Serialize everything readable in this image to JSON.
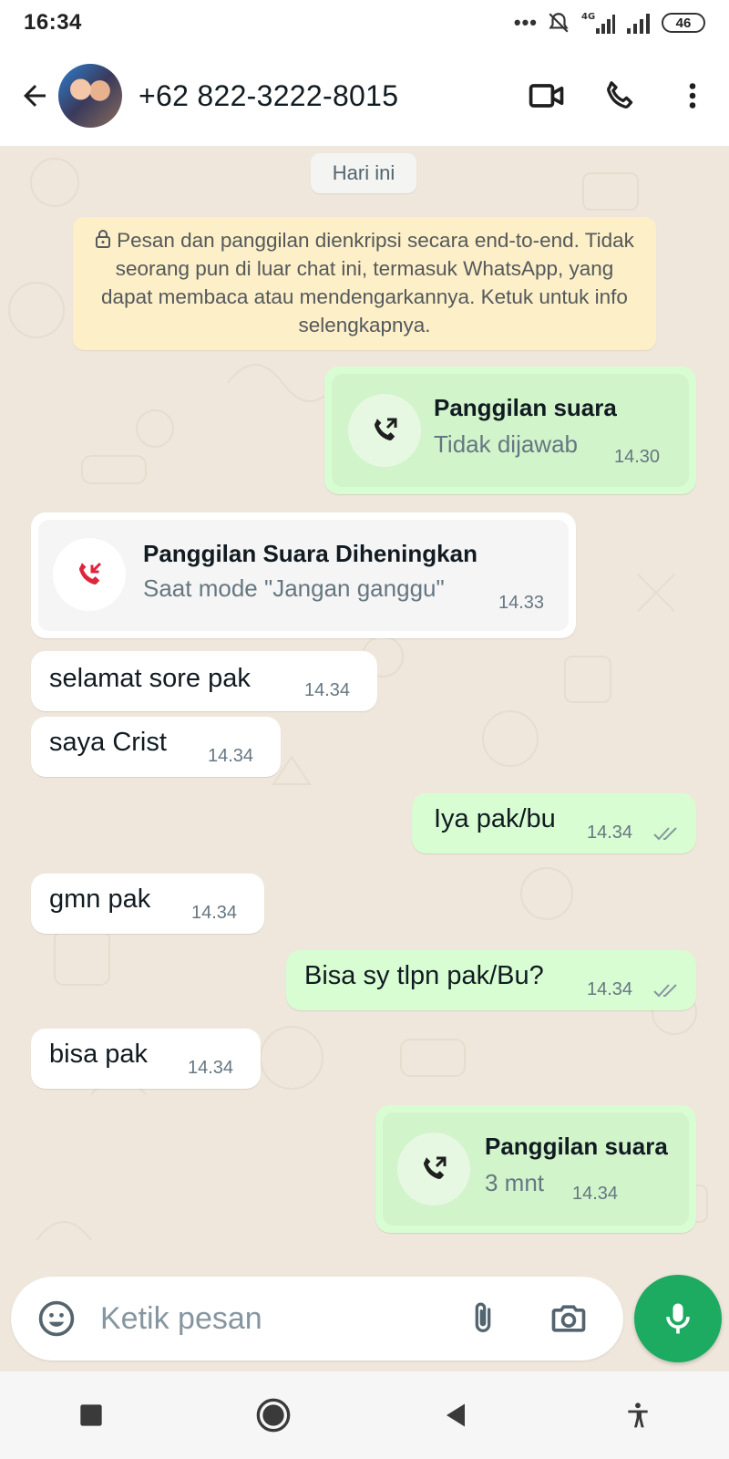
{
  "status_bar": {
    "time": "16:34",
    "dots": "•••",
    "network_label": "4G",
    "battery": "46"
  },
  "header": {
    "contact_name": "+62 822-3222-8015",
    "icons": [
      "back-arrow-icon",
      "avatar",
      "video-call-icon",
      "phone-icon",
      "more-vert-icon"
    ]
  },
  "chat": {
    "date_chip": "Hari ini",
    "encryption_notice": "Pesan dan panggilan dienkripsi secara end-to-end. Tidak seorang pun di luar chat ini, termasuk WhatsApp, yang dapat membaca atau mendengarkannya. Ketuk untuk info selengkapnya.",
    "messages": [
      {
        "direction": "out",
        "kind": "call",
        "title": "Panggilan suara",
        "subtitle": "Tidak dijawab",
        "time": "14.30"
      },
      {
        "direction": "in",
        "kind": "call",
        "title": "Panggilan Suara Diheningkan",
        "subtitle": "Saat mode \"Jangan ganggu\"",
        "time": "14.33"
      },
      {
        "direction": "in",
        "kind": "text",
        "text": "selamat sore pak",
        "time": "14.34"
      },
      {
        "direction": "in",
        "kind": "text",
        "text": "saya Crist",
        "time": "14.34"
      },
      {
        "direction": "out",
        "kind": "text",
        "text": "Iya pak/bu",
        "time": "14.34",
        "status": "read"
      },
      {
        "direction": "in",
        "kind": "text",
        "text": "gmn pak",
        "time": "14.34"
      },
      {
        "direction": "out",
        "kind": "text",
        "text": "Bisa sy tlpn pak/Bu?",
        "time": "14.34",
        "status": "read"
      },
      {
        "direction": "in",
        "kind": "text",
        "text": "bisa pak",
        "time": "14.34"
      },
      {
        "direction": "out",
        "kind": "call",
        "title": "Panggilan suara",
        "subtitle": "3 mnt",
        "time": "14.34"
      }
    ]
  },
  "composer": {
    "placeholder": "Ketik pesan"
  },
  "colors": {
    "outgoing_bubble": "#d9fdd3",
    "incoming_bubble": "#ffffff",
    "chat_background": "#efe7dc",
    "notice_background": "#fdefc7",
    "accent_green": "#1daa61",
    "missed_call_red": "#e0243c",
    "read_ticks": "#8696a0"
  }
}
